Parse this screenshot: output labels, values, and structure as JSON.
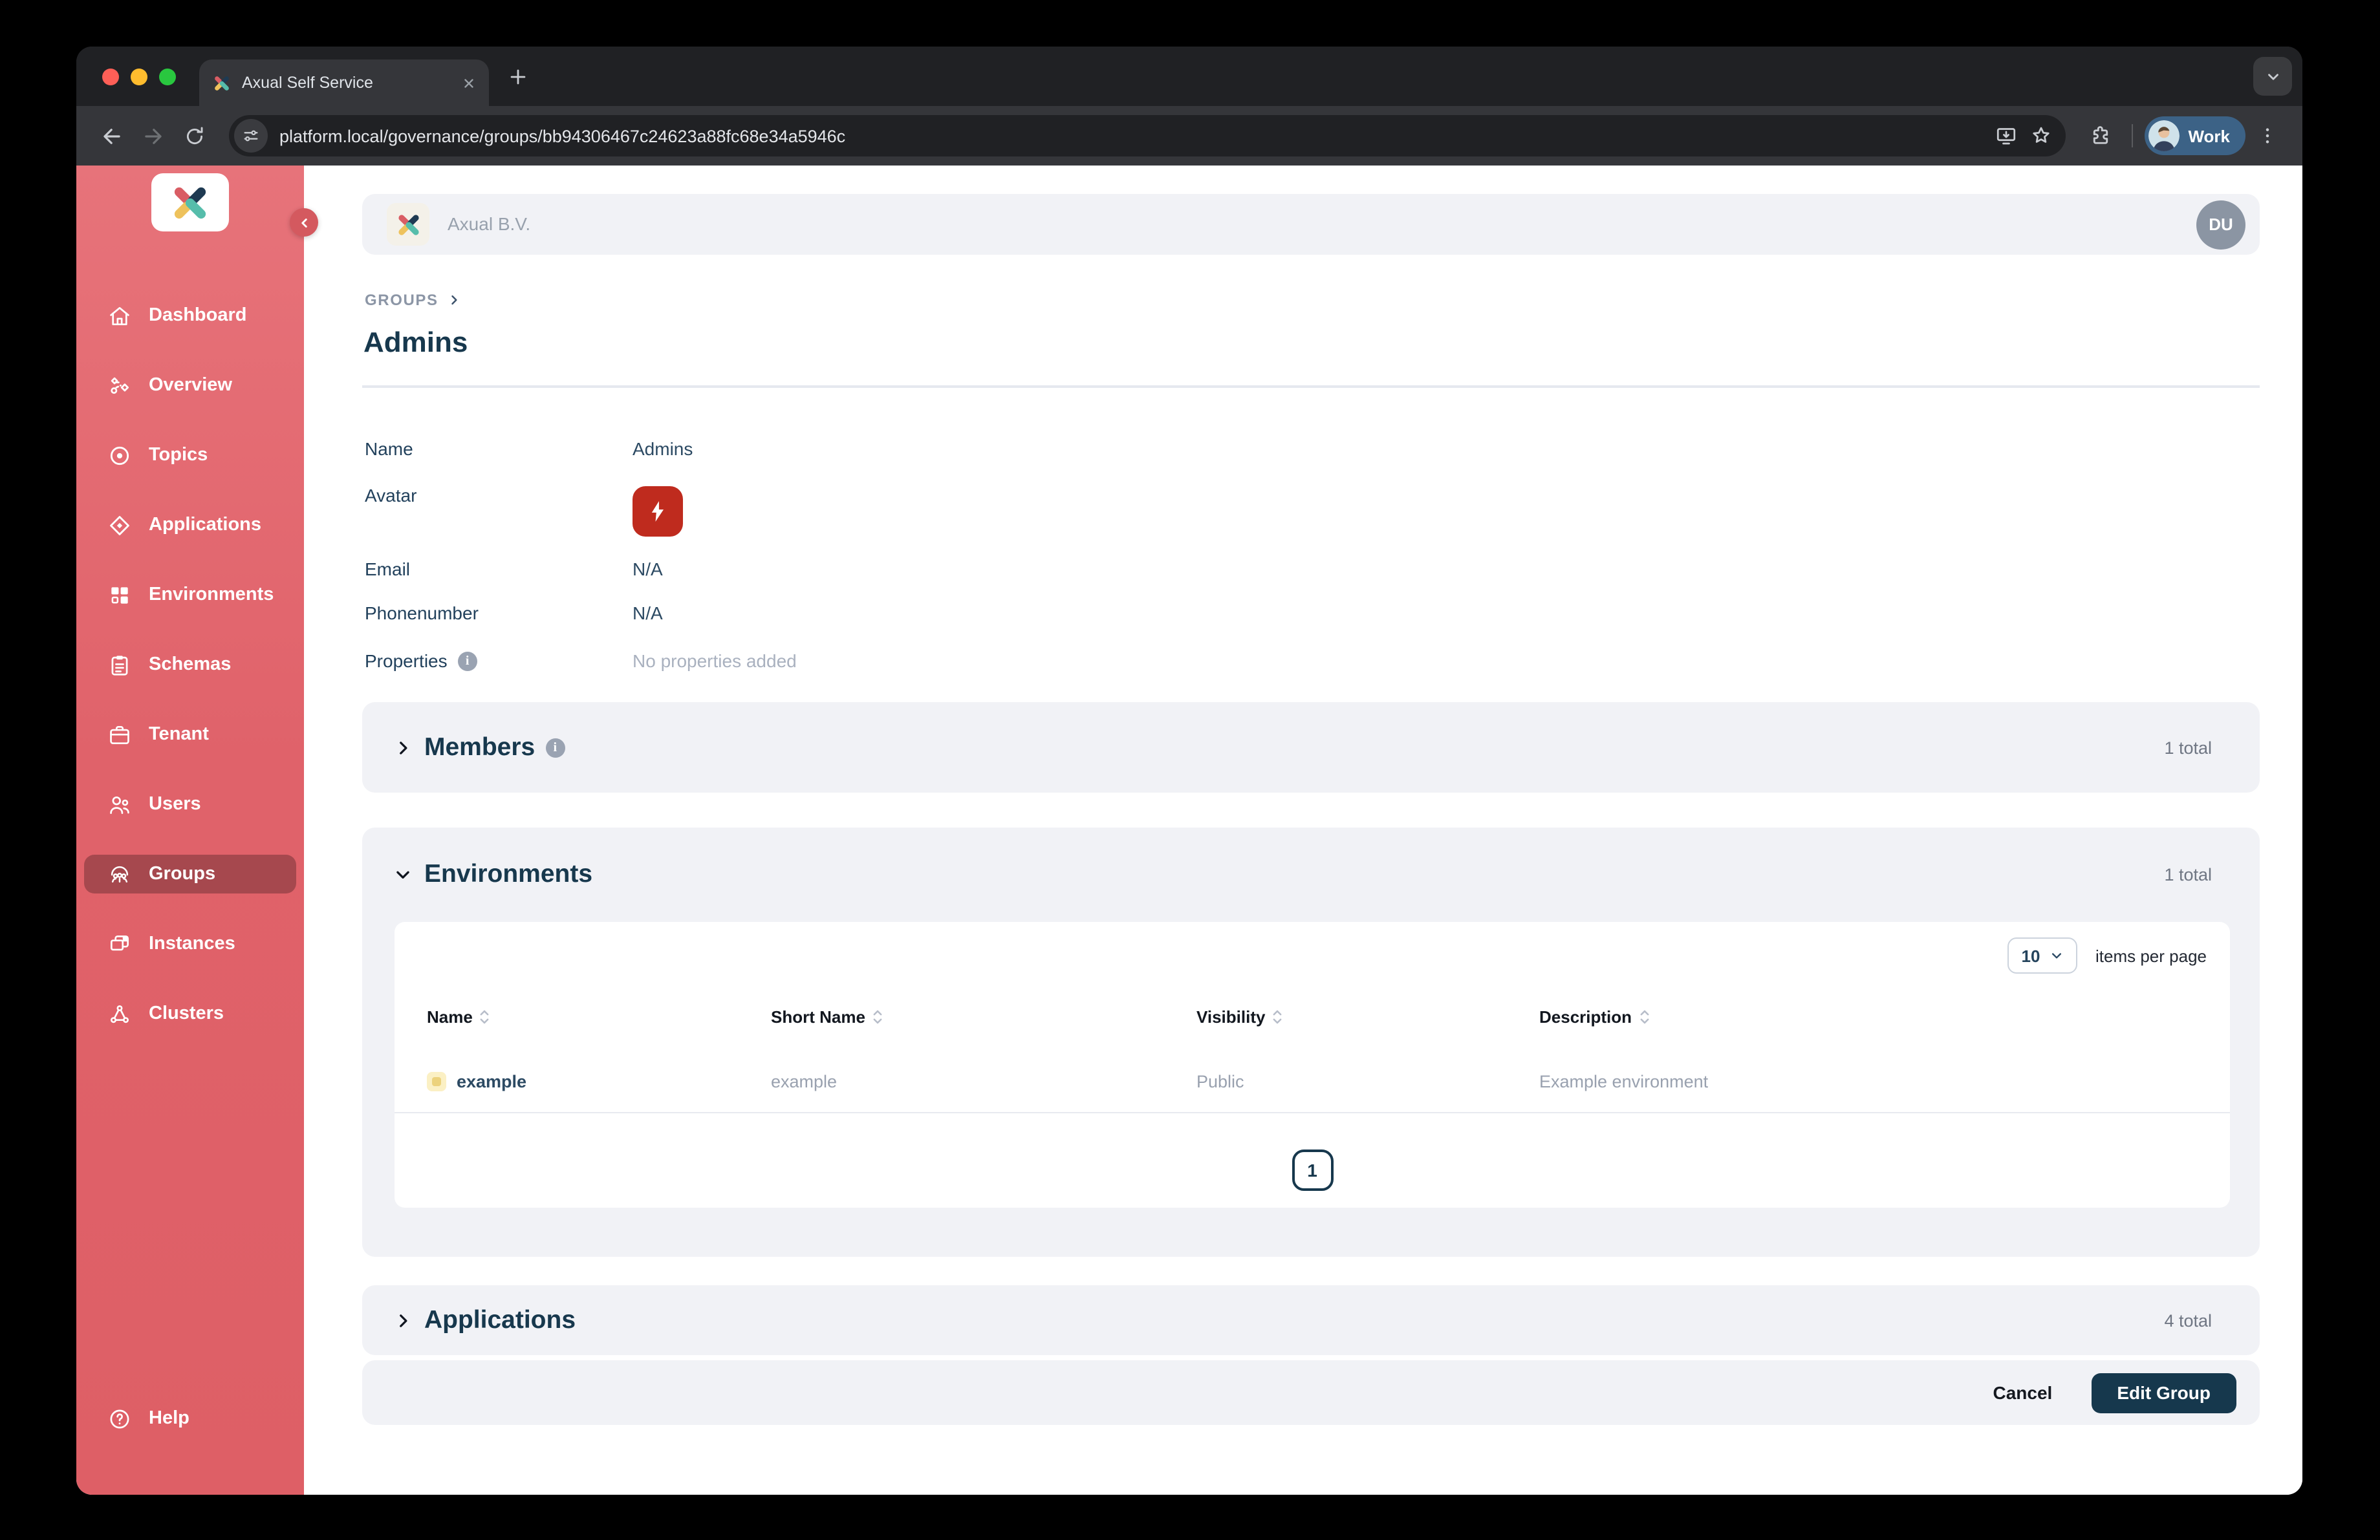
{
  "colors": {
    "sidebar_red": "#e0626a",
    "sidebar_active": "#a6484e",
    "navy": "#17384d",
    "panel_gray": "#f1f2f6",
    "avatar_tile_red": "#bf2b1e",
    "env_icon_yellow": "#ecd27c",
    "profile_chip_blue": "#3c6286",
    "du_avatar_gray": "#8b95a3"
  },
  "browser": {
    "tab_title": "Axual Self Service",
    "url": "platform.local/governance/groups/bb94306467c24623a88fc68e34a5946c",
    "profile_label": "Work"
  },
  "sidebar": {
    "items": [
      "Dashboard",
      "Overview",
      "Topics",
      "Applications",
      "Environments",
      "Schemas",
      "Tenant",
      "Users",
      "Groups",
      "Instances",
      "Clusters"
    ],
    "help_label": "Help"
  },
  "org_header": {
    "org_name": "Axual B.V.",
    "avatar_initials": "DU"
  },
  "page": {
    "breadcrumb": "GROUPS",
    "title": "Admins",
    "fields": {
      "name_label": "Name",
      "name_value": "Admins",
      "avatar_label": "Avatar",
      "email_label": "Email",
      "email_value": "N/A",
      "phone_label": "Phonenumber",
      "phone_value": "N/A",
      "properties_label": "Properties",
      "properties_value": "No properties added"
    }
  },
  "sections": {
    "members": {
      "title": "Members",
      "total": "1 total"
    },
    "environments": {
      "title": "Environments",
      "total": "1 total",
      "items_per_page_value": "10",
      "items_per_page_label": "items per page",
      "table": {
        "columns": [
          "Name",
          "Short Name",
          "Visibility",
          "Description"
        ],
        "rows": [
          {
            "name": "example",
            "short_name": "example",
            "visibility": "Public",
            "description": "Example environment"
          }
        ]
      },
      "pagination_page": "1"
    },
    "applications": {
      "title": "Applications",
      "total": "4 total"
    }
  },
  "actions": {
    "cancel_label": "Cancel",
    "edit_label": "Edit Group"
  }
}
